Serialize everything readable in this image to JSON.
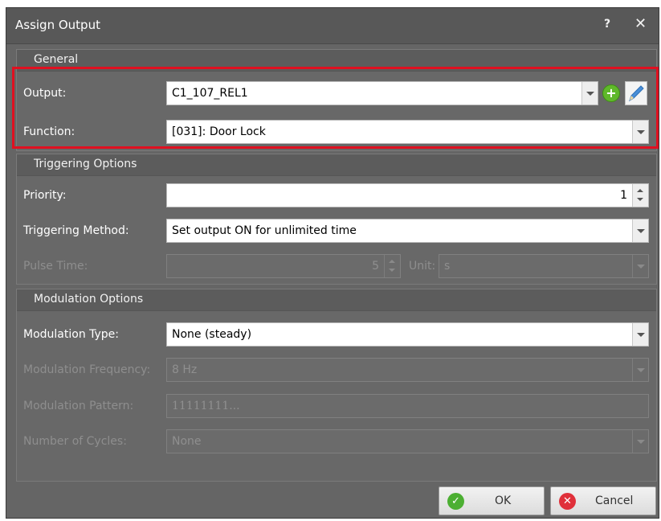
{
  "dialog": {
    "title": "Assign Output",
    "help_glyph": "?",
    "close_glyph": "✕"
  },
  "general": {
    "title": "General",
    "output_label": "Output:",
    "output_value": "C1_107_REL1",
    "function_label": "Function:",
    "function_value": "[031]: Door Lock"
  },
  "triggering": {
    "title": "Triggering Options",
    "priority_label": "Priority:",
    "priority_value": "1",
    "method_label": "Triggering Method:",
    "method_value": "Set output ON for unlimited time",
    "pulse_label": "Pulse Time:",
    "pulse_value": "5",
    "unit_label": "Unit:",
    "unit_value": "s"
  },
  "modulation": {
    "title": "Modulation Options",
    "type_label": "Modulation Type:",
    "type_value": "None (steady)",
    "frequency_label": "Modulation Frequency:",
    "frequency_value": "8 Hz",
    "pattern_label": "Modulation Pattern:",
    "pattern_value": "11111111...",
    "cycles_label": "Number of Cycles:",
    "cycles_value": "None"
  },
  "buttons": {
    "ok_label": "OK",
    "cancel_label": "Cancel"
  },
  "colors": {
    "highlight": "#e01020",
    "ok_icon": "#4caf32",
    "cancel_icon": "#e0303a",
    "add_icon": "#5fb82a"
  },
  "icons": {
    "help": "help-icon",
    "close": "close-icon",
    "add": "plus-circle-icon",
    "edit": "pencil-icon",
    "ok": "check-circle-icon",
    "cancel": "x-circle-icon"
  }
}
